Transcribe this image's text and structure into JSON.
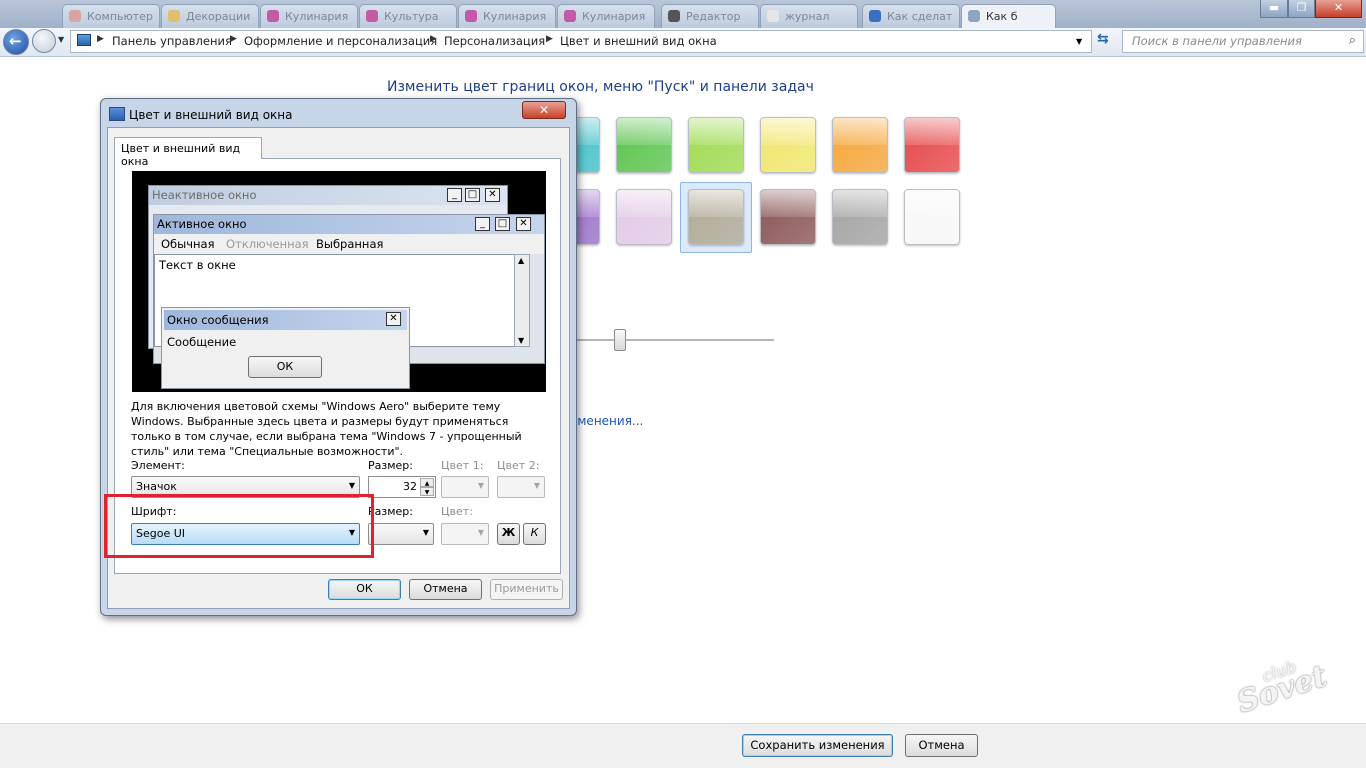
{
  "browser_tabs": [
    "Компьютер",
    "Декорации",
    "Кулинария",
    "Культура",
    "Кулинария",
    "Кулинария",
    "Редактор",
    "журнал",
    "Как сделат",
    "Как б"
  ],
  "address": {
    "crumbs": [
      "Панель управления",
      "Оформление и персонализация",
      "Персонализация",
      "Цвет и внешний вид окна"
    ],
    "search_placeholder": "Поиск в панели управления"
  },
  "main": {
    "heading": "Изменить цвет границ окон, меню \"Пуск\" и панели задач",
    "swatches": [
      {
        "color": "#3fc0c9"
      },
      {
        "color": "#5cc44e"
      },
      {
        "color": "#9edb52"
      },
      {
        "color": "#f1e66b"
      },
      {
        "color": "#f5a63a"
      },
      {
        "color": "#e64848"
      },
      {
        "color": "#9a6ec8"
      },
      {
        "color": "#e2c9e6"
      },
      {
        "color": "#b3ab96"
      },
      {
        "color": "#8a5656"
      },
      {
        "color": "#a3a3a3"
      },
      {
        "color": "#f7f7f7"
      }
    ],
    "advanced_link": "зменения..."
  },
  "dialog": {
    "title": "Цвет и внешний вид окна",
    "close": "✕",
    "tab_label": "Цвет и внешний вид окна",
    "preview": {
      "inactive_title": "Неактивное окно",
      "active_title": "Активное окно",
      "menu_normal": "Обычная",
      "menu_disabled": "Отключенная",
      "menu_selected": "Выбранная",
      "window_text": "Текст в окне",
      "msgbox_title": "Окно сообщения",
      "msgbox_text": "Сообщение",
      "msgbox_ok": "ОК"
    },
    "description": "Для включения цветовой схемы \"Windows Aero\" выберите тему Windows. Выбранные здесь цвета и размеры будут применяться только в том случае, если выбрана тема \"Windows 7 - упрощенный стиль\" или тема \"Специальные возможности\".",
    "element_label": "Элемент:",
    "element_value": "Значок",
    "size_label": "Размер:",
    "size_value": "32",
    "color1_label": "Цвет 1:",
    "color2_label": "Цвет 2:",
    "font_label": "Шрифт:",
    "font_value": "Segoe UI",
    "font_size_label": "Размер:",
    "font_color_label": "Цвет:",
    "bold_label": "Ж",
    "italic_label": "К",
    "ok": "ОК",
    "cancel": "Отмена",
    "apply": "Применить"
  },
  "bottom": {
    "save": "Сохранить изменения",
    "cancel": "Отмена"
  },
  "watermark": {
    "main": "Sovet",
    "sub": "club"
  },
  "colors": {
    "highlight": "#e0222e",
    "accent": "#1e3e8c",
    "link": "#1a56b8"
  }
}
